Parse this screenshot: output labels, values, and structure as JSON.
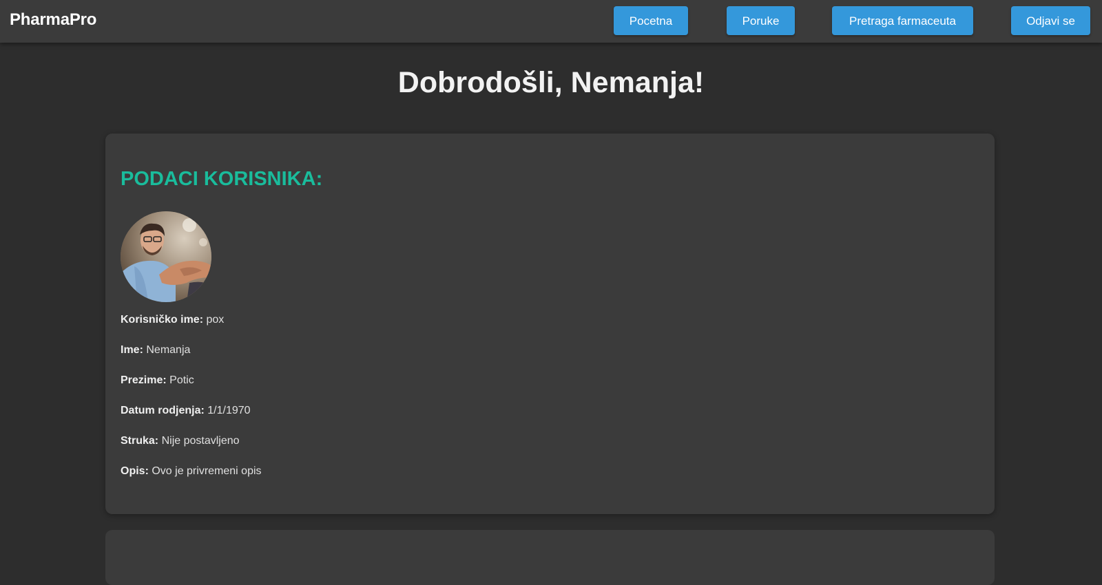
{
  "app": {
    "brand": "PharmaPro"
  },
  "nav": {
    "home": "Pocetna",
    "messages": "Poruke",
    "search": "Pretraga farmaceuta",
    "logout": "Odjavi se"
  },
  "welcome": "Dobrodošli, Nemanja!",
  "profile": {
    "section_title": "PODACI KORISNIKA:",
    "avatar_icon": "user-avatar-photo",
    "fields": [
      {
        "label": "Korisničko ime:",
        "value": "pox"
      },
      {
        "label": "Ime:",
        "value": "Nemanja"
      },
      {
        "label": "Prezime:",
        "value": "Potic"
      },
      {
        "label": "Datum rodjenja:",
        "value": "1/1/1970"
      },
      {
        "label": "Struka:",
        "value": "Nije postavljeno"
      },
      {
        "label": "Opis:",
        "value": "Ovo je privremeni opis"
      }
    ]
  },
  "colors": {
    "background": "#2d2d2d",
    "navbar": "#3b3b3b",
    "card": "#3b3b3b",
    "button": "#3498db",
    "accent": "#1abc9c"
  }
}
